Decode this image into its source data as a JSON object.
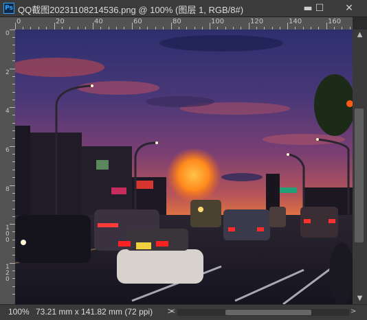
{
  "window": {
    "app_icon": "Ps",
    "title": "QQ截图20231108214536.png @ 100% (图层 1, RGB/8#)",
    "minimize": "▬",
    "maximize": "☐",
    "close": "✕"
  },
  "ruler": {
    "h_labels": [
      "0",
      "20",
      "40",
      "60",
      "80",
      "100",
      "120",
      "140",
      "160"
    ],
    "v_labels": [
      "0",
      "2",
      "4",
      "6",
      "8",
      "1\n0\n0",
      "1\n2\n0"
    ]
  },
  "status": {
    "zoom": "100%",
    "doc_info": "73.21 mm x 141.82 mm (72 ppi)",
    "left_arrow": "<",
    "right_arrow": ">"
  },
  "colors": {
    "chrome": "#3b3b3b",
    "ruler": "#535353",
    "accent": "#31a8ff"
  }
}
